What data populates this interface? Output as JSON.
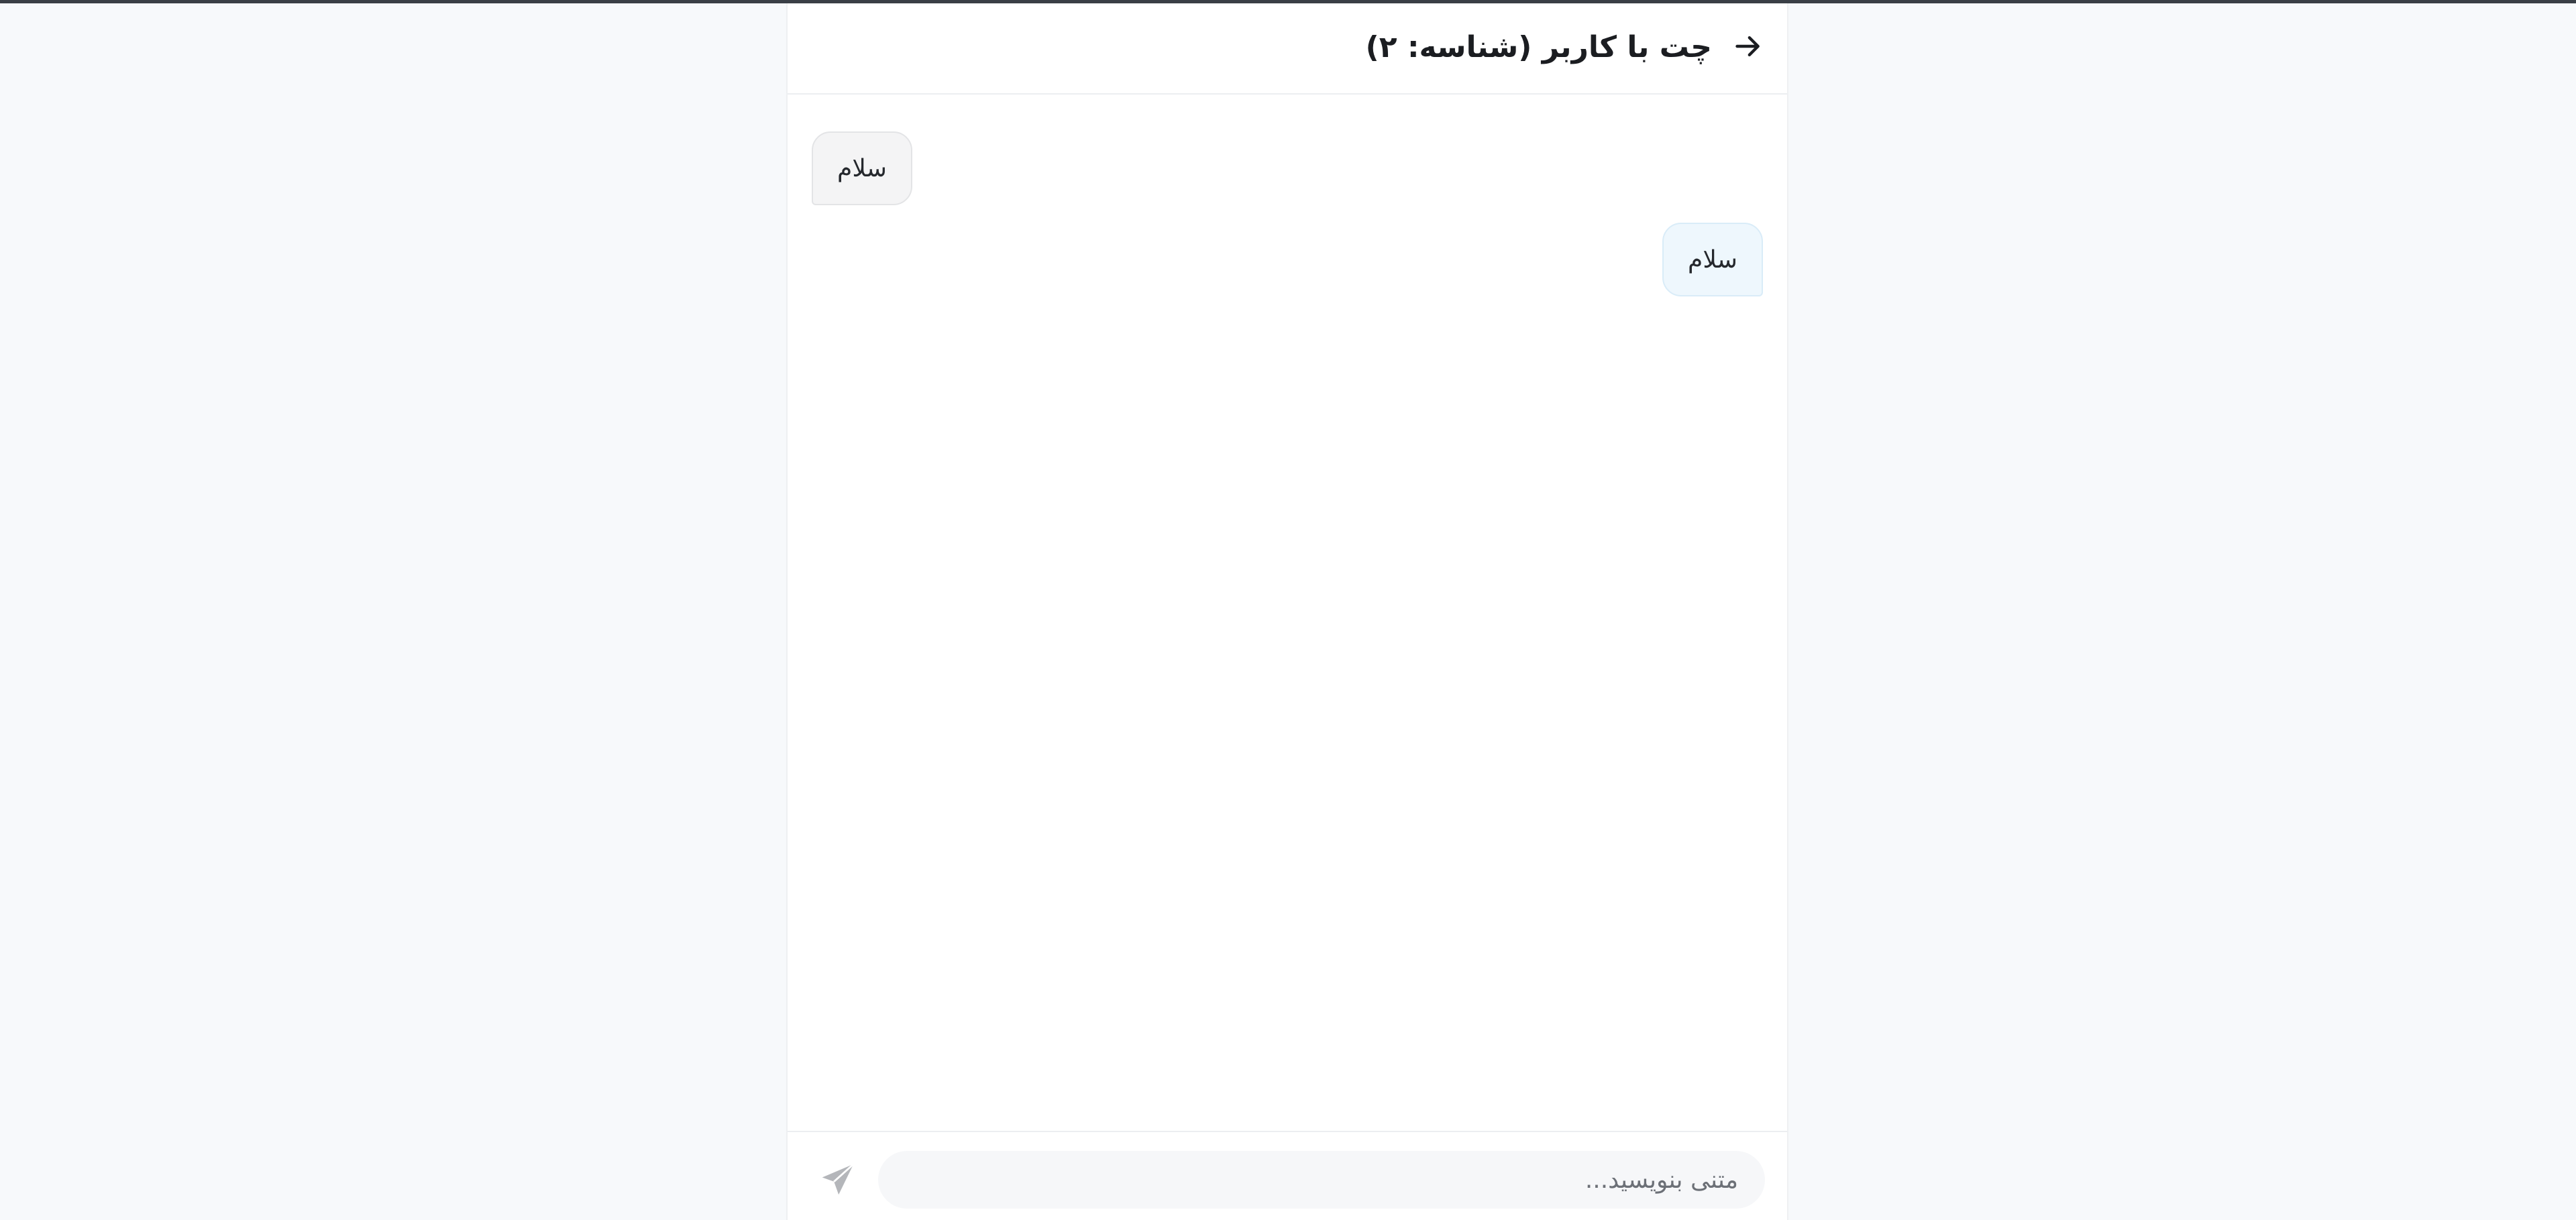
{
  "header": {
    "back_icon": "arrow-right-icon",
    "title": "چت با کاربر (شناسه: ۲)"
  },
  "messages": [
    {
      "direction": "incoming",
      "text": "سلام"
    },
    {
      "direction": "outgoing",
      "text": "سلام"
    }
  ],
  "composer": {
    "placeholder": "متنی بنویسید...",
    "value": "",
    "send_icon": "paper-plane-icon"
  },
  "colors": {
    "incoming_bubble": "#f4f4f5",
    "outgoing_bubble": "#eef7fd",
    "send_icon": "#b4b6ba"
  }
}
